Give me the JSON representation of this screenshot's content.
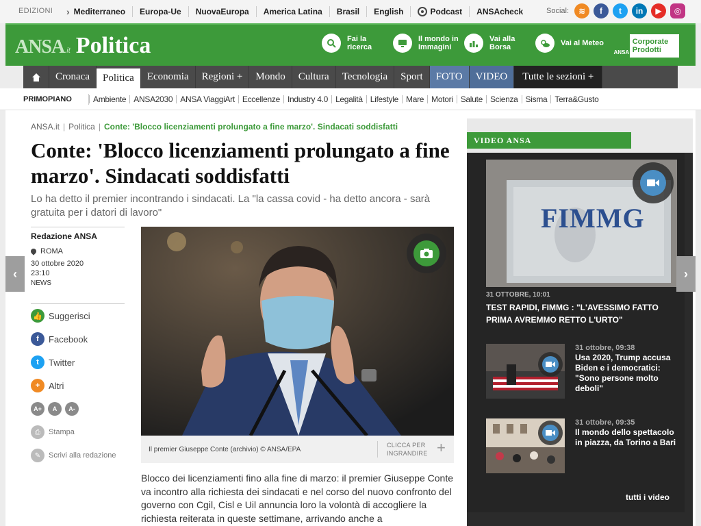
{
  "editions": {
    "label": "EDIZIONI",
    "items": [
      "Mediterraneo",
      "Europa-Ue",
      "NuovaEuropa",
      "America Latina",
      "Brasil",
      "English",
      "Podcast",
      "ANSAcheck"
    ],
    "social_label": "Social:"
  },
  "header": {
    "brand": "ANSA",
    "brand_suffix": ".it",
    "section": "Politica",
    "tools": [
      {
        "label": "Fai la ricerca",
        "icon": "search-icon"
      },
      {
        "label": "Il mondo in Immagini",
        "icon": "screen-icon"
      },
      {
        "label": "Vai alla Borsa",
        "icon": "chart-icon"
      },
      {
        "label": "Vai al Meteo",
        "icon": "weather-icon"
      }
    ],
    "corporate_label": "Corporate Prodotti",
    "corporate_logo": "ANSA"
  },
  "nav": {
    "items": [
      "Cronaca",
      "Politica",
      "Economia",
      "Regioni +",
      "Mondo",
      "Cultura",
      "Tecnologia",
      "Sport",
      "FOTO",
      "VIDEO",
      "Tutte le sezioni +"
    ],
    "active": "Politica"
  },
  "subnav": {
    "label": "PRIMOPIANO",
    "items": [
      "Ambiente",
      "ANSA2030",
      "ANSA ViaggiArt",
      "Eccellenze",
      "Industry 4.0",
      "Legalità",
      "Lifestyle",
      "Mare",
      "Motori",
      "Salute",
      "Scienza",
      "Sisma",
      "Terra&Gusto"
    ]
  },
  "article": {
    "breadcrumb": [
      "ANSA.it",
      "Politica",
      "Conte: 'Blocco licenziamenti prolungato a fine marzo'. Sindacati soddisfatti"
    ],
    "headline": "Conte: 'Blocco licenziamenti prolungato a fine marzo'. Sindacati soddisfatti",
    "summary": "Lo ha detto il premier incontrando i sindacati. La \"la cassa covid - ha detto ancora - sarà gratuita per i datori di lavoro\"",
    "author": "Redazione ANSA",
    "location": "ROMA",
    "date": "30 ottobre 2020",
    "time": "23:10",
    "category": "NEWS",
    "caption": "Il premier Giuseppe Conte (archivio) © ANSA/EPA",
    "zoom_label": "CLICCA PER INGRANDIRE",
    "body": "Blocco dei licenziamenti fino alla fine di marzo: il premier Giuseppe Conte va incontro alla richiesta dei sindacati e nel corso del nuovo confronto del governo con Cgil, Cisl e Uil annuncia loro la volontà di accogliere la richiesta reiterata in queste settimane, arrivando anche a"
  },
  "share": {
    "suggest": "Suggerisci",
    "facebook": "Facebook",
    "twitter": "Twitter",
    "other": "Altri",
    "font_sizes": [
      "A+",
      "A",
      "A-"
    ],
    "print": "Stampa",
    "write": "Scrivi alla redazione"
  },
  "video": {
    "tab_label": "VIDEO ANSA",
    "main": {
      "date": "31 OTTOBRE, 10:01",
      "title": "TEST RAPIDI, FIMMG : \"L'AVESSIMO FATTO PRIMA AVREMMO RETTO L'URTO\"",
      "sign_text": "FIMMG"
    },
    "items": [
      {
        "date": "31 ottobre, 09:38",
        "title": "Usa 2020, Trump accusa Biden e i democratici: \"Sono persone molto deboli\""
      },
      {
        "date": "31 ottobre, 09:35",
        "title": "Il mondo dello spettacolo in piazza, da Torino a Bari"
      }
    ],
    "all_label": "tutti i video"
  },
  "colors": {
    "brand_green": "#3d9a3a",
    "nav_dark": "#4a4a4a",
    "video_blue": "#4a8ec4"
  }
}
